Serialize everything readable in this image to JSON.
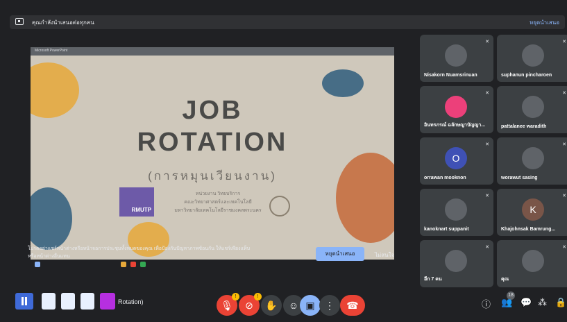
{
  "topbar": {
    "title": "คุณกำลังนำเสนอต่อทุกคน",
    "stop_label": "หยุดนำเสนอ"
  },
  "slide": {
    "window_title": "Microsoft PowerPoint",
    "title_line1": "JOB",
    "title_line2": "ROTATION",
    "subtitle": "(การหมุนเวียนงาน)",
    "logo_text": "RMUTP",
    "org_line1": "หน่วยงาน วิทยบริการ",
    "org_line2": "คณะวิทยาศาสตร์และเทคโนโลยี",
    "org_line3": "มหาวิทยาลัยเทคโนโลยีราชมงคลพระนคร"
  },
  "notice": {
    "text": "โปรดอย่าแชร์หน้าต่างหรือหน้าจอการประชุมทั้งหมดของคุณ เพื่อป้องกันปัญหาภาพซ้อนกัน ให้แชร์เพียงแท็บหรือหน้าต่างอื่นแทน",
    "present_label": "หยุดนำเสนอ",
    "ignore_label": "ไม่สนใจ"
  },
  "participants": [
    {
      "name": "Nisakorn Nuamsrinuan",
      "color": "#5f6368",
      "initial": ""
    },
    {
      "name": "suphanun pincharoen",
      "color": "#5f6368",
      "initial": ""
    },
    {
      "name": "อินทรภรณ์ ฉลักษญาบัญญา...",
      "color": "#ec407a",
      "initial": ""
    },
    {
      "name": "pattalanee waradith",
      "color": "#5f6368",
      "initial": ""
    },
    {
      "name": "orrawan mooknon",
      "color": "#3f51b5",
      "initial": "O"
    },
    {
      "name": "worawut sasing",
      "color": "#5f6368",
      "initial": ""
    },
    {
      "name": "kanoknart suppanit",
      "color": "#5f6368",
      "initial": ""
    },
    {
      "name": "Khajohnsak Bamrung...",
      "color": "#795548",
      "initial": "K"
    },
    {
      "name": "อีก 7 คน",
      "color": "#5f6368",
      "initial": ""
    },
    {
      "name": "คุณ",
      "color": "#5f6368",
      "initial": ""
    }
  ],
  "bottom": {
    "pinned_text": "Rotation)",
    "participant_count": "18"
  },
  "colors": {
    "accent": "#8ab4f8",
    "danger": "#ea4335",
    "tile_bg": "#3c4043",
    "bg": "#202124"
  }
}
